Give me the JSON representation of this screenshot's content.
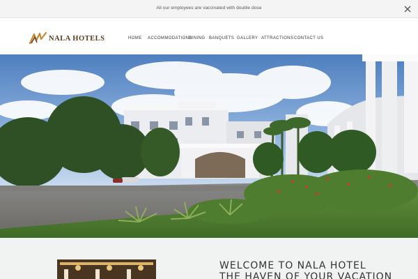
{
  "announcement": {
    "text": "All our employees are vaccinated with double dose"
  },
  "brand": {
    "name": "NALA HOTELS",
    "color": "#5a3a1c"
  },
  "nav": {
    "items": [
      {
        "label": "HOME"
      },
      {
        "label": "ACCOMMODATIONS"
      },
      {
        "label": "DINING"
      },
      {
        "label": "BANQUETS"
      },
      {
        "label": "GALLERY"
      },
      {
        "label": "ATTRACTIONS"
      },
      {
        "label": "CONTACT US"
      }
    ]
  },
  "welcome": {
    "title": "WELCOME TO NALA HOTEL",
    "subtitle": "THE HAVEN OF YOUR VACATION"
  },
  "icons": {
    "close": "close-icon",
    "logo": "logo-mark-icon"
  }
}
